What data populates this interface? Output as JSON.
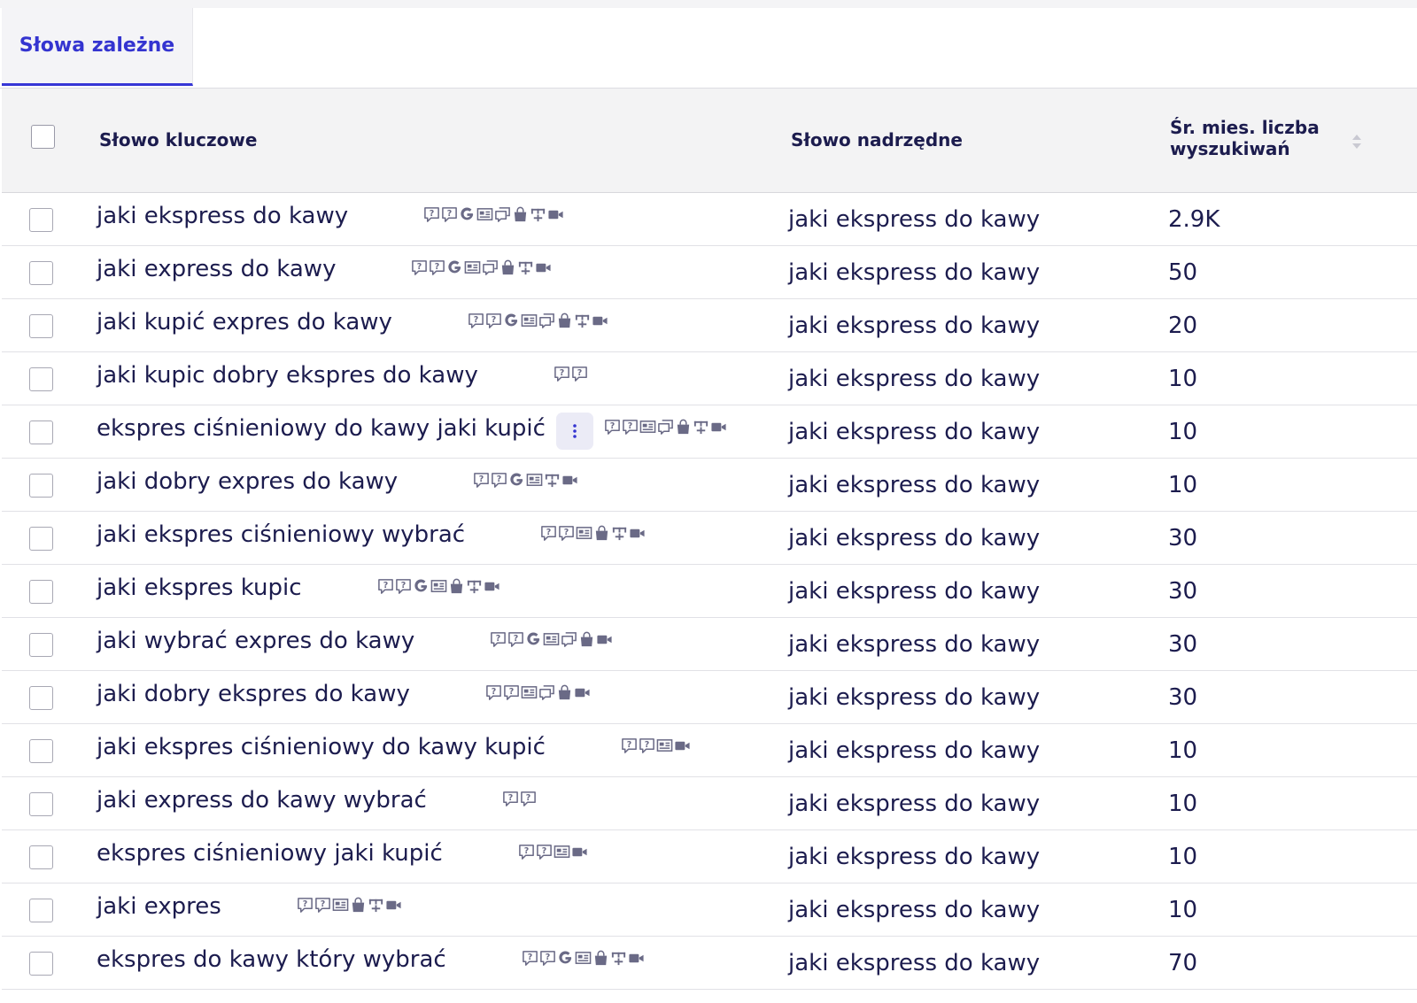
{
  "tabs": {
    "active_label": "Słowa zależne"
  },
  "columns": {
    "keyword": "Słowo kluczowe",
    "parent": "Słowo nadrzędne",
    "volume_line1": "Śr. mies. liczba",
    "volume_line2": "wyszukiwań"
  },
  "colors": {
    "accent": "#3434d0",
    "text": "#1c1c4e",
    "icon": "#6a6a86",
    "header_bg": "#f3f3f4"
  },
  "rows": [
    {
      "keyword": "jaki ekspress do kawy",
      "parent": "jaki ekspress do kawy",
      "volume": "2.9K",
      "serp_features": [
        "question",
        "question",
        "google",
        "snippet",
        "reviews",
        "shopping",
        "sitelinks",
        "video"
      ]
    },
    {
      "keyword": "jaki express do kawy",
      "parent": "jaki ekspress do kawy",
      "volume": "50",
      "serp_features": [
        "question",
        "question",
        "google",
        "snippet",
        "reviews",
        "shopping",
        "sitelinks",
        "video"
      ]
    },
    {
      "keyword": "jaki kupić expres do kawy",
      "parent": "jaki ekspress do kawy",
      "volume": "20",
      "serp_features": [
        "question",
        "question",
        "google",
        "snippet",
        "reviews",
        "shopping",
        "sitelinks",
        "video"
      ]
    },
    {
      "keyword": "jaki kupic dobry ekspres do kawy",
      "parent": "jaki ekspress do kawy",
      "volume": "10",
      "serp_features": [
        "question",
        "question"
      ]
    },
    {
      "keyword": "ekspres ciśnieniowy do kawy jaki kupić",
      "parent": "jaki ekspress do kawy",
      "volume": "10",
      "has_menu": true,
      "serp_features": [
        "question",
        "question",
        "snippet",
        "reviews",
        "shopping",
        "sitelinks",
        "video"
      ]
    },
    {
      "keyword": "jaki dobry expres do kawy",
      "parent": "jaki ekspress do kawy",
      "volume": "10",
      "serp_features": [
        "question",
        "question",
        "google",
        "snippet",
        "sitelinks",
        "video"
      ]
    },
    {
      "keyword": "jaki ekspres ciśnieniowy wybrać",
      "parent": "jaki ekspress do kawy",
      "volume": "30",
      "serp_features": [
        "question",
        "question",
        "snippet",
        "shopping",
        "sitelinks",
        "video"
      ]
    },
    {
      "keyword": "jaki ekspres kupic",
      "parent": "jaki ekspress do kawy",
      "volume": "30",
      "serp_features": [
        "question",
        "question",
        "google",
        "snippet",
        "shopping",
        "sitelinks",
        "video"
      ]
    },
    {
      "keyword": "jaki wybrać expres do kawy",
      "parent": "jaki ekspress do kawy",
      "volume": "30",
      "serp_features": [
        "question",
        "question",
        "google",
        "snippet",
        "reviews",
        "shopping",
        "video"
      ]
    },
    {
      "keyword": "jaki dobry ekspres do kawy",
      "parent": "jaki ekspress do kawy",
      "volume": "30",
      "serp_features": [
        "question",
        "question",
        "snippet",
        "reviews",
        "shopping",
        "video"
      ]
    },
    {
      "keyword": "jaki ekspres ciśnieniowy do kawy kupić",
      "parent": "jaki ekspress do kawy",
      "volume": "10",
      "serp_features": [
        "question",
        "question",
        "snippet",
        "video"
      ]
    },
    {
      "keyword": "jaki express do kawy wybrać",
      "parent": "jaki ekspress do kawy",
      "volume": "10",
      "serp_features": [
        "question",
        "question"
      ]
    },
    {
      "keyword": "ekspres ciśnieniowy jaki kupić",
      "parent": "jaki ekspress do kawy",
      "volume": "10",
      "serp_features": [
        "question",
        "question",
        "snippet",
        "video"
      ]
    },
    {
      "keyword": "jaki expres",
      "parent": "jaki ekspress do kawy",
      "volume": "10",
      "serp_features": [
        "question",
        "question",
        "snippet",
        "shopping",
        "sitelinks",
        "video"
      ]
    },
    {
      "keyword": "ekspres do kawy który wybrać",
      "parent": "jaki ekspress do kawy",
      "volume": "70",
      "serp_features": [
        "question",
        "question",
        "google",
        "snippet",
        "shopping",
        "sitelinks",
        "video"
      ]
    }
  ]
}
